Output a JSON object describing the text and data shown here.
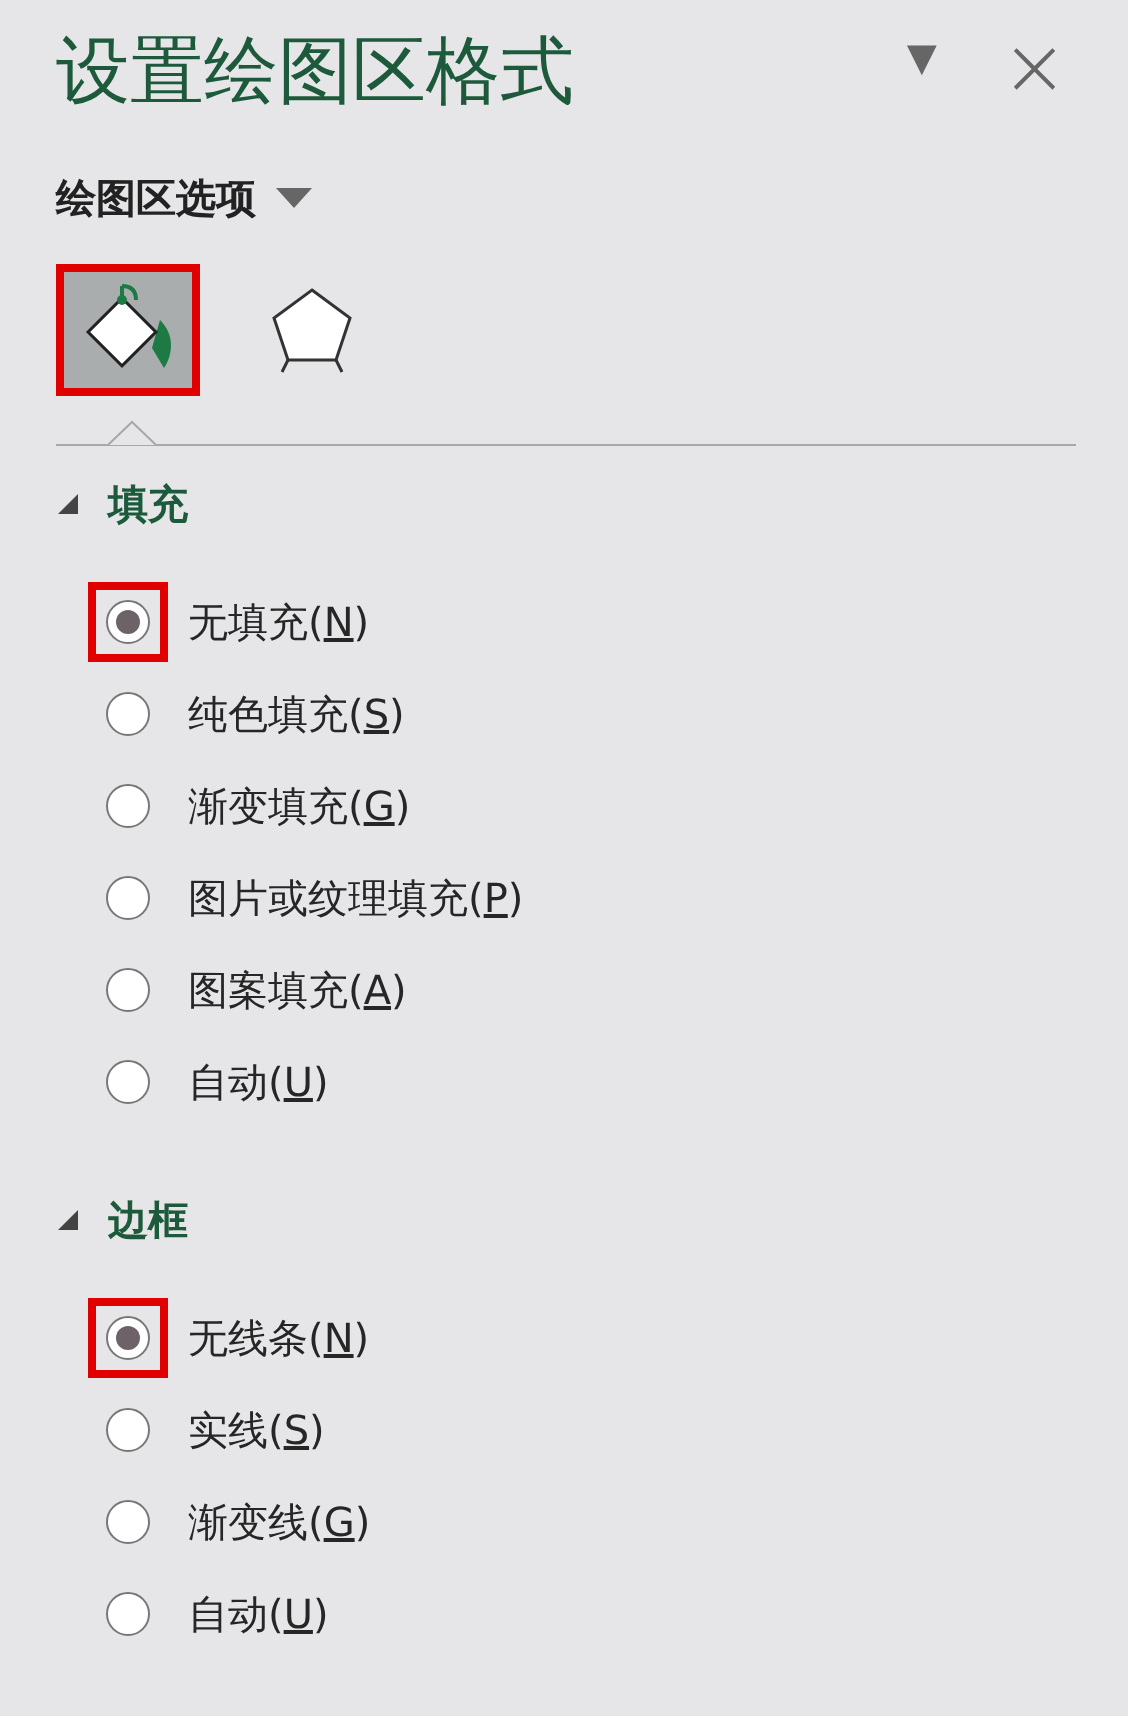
{
  "panel": {
    "title": "设置绘图区格式",
    "menu_button": "▾",
    "close_button": "×"
  },
  "options_menu": {
    "label": "绘图区选项"
  },
  "icon_tabs": [
    {
      "kind": "fill",
      "selected": true,
      "highlighted": true
    },
    {
      "kind": "shape",
      "selected": false,
      "highlighted": false
    }
  ],
  "sections": [
    {
      "title": "填充",
      "expanded": true,
      "options": [
        {
          "label_start": "无填充(",
          "access_key": "N",
          "label_end": ")",
          "selected": true,
          "highlighted": true
        },
        {
          "label_start": "纯色填充(",
          "access_key": "S",
          "label_end": ")",
          "selected": false,
          "highlighted": false
        },
        {
          "label_start": "渐变填充(",
          "access_key": "G",
          "label_end": ")",
          "selected": false,
          "highlighted": false
        },
        {
          "label_start": "图片或纹理填充(",
          "access_key": "P",
          "label_end": ")",
          "selected": false,
          "highlighted": false
        },
        {
          "label_start": "图案填充(",
          "access_key": "A",
          "label_end": ")",
          "selected": false,
          "highlighted": false
        },
        {
          "label_start": "自动(",
          "access_key": "U",
          "label_end": ")",
          "selected": false,
          "highlighted": false
        }
      ]
    },
    {
      "title": "边框",
      "expanded": true,
      "options": [
        {
          "label_start": "无线条(",
          "access_key": "N",
          "label_end": ")",
          "selected": true,
          "highlighted": true
        },
        {
          "label_start": "实线(",
          "access_key": "S",
          "label_end": ")",
          "selected": false,
          "highlighted": false
        },
        {
          "label_start": "渐变线(",
          "access_key": "G",
          "label_end": ")",
          "selected": false,
          "highlighted": false
        },
        {
          "label_start": "自动(",
          "access_key": "U",
          "label_end": ")",
          "selected": false,
          "highlighted": false
        }
      ]
    }
  ]
}
